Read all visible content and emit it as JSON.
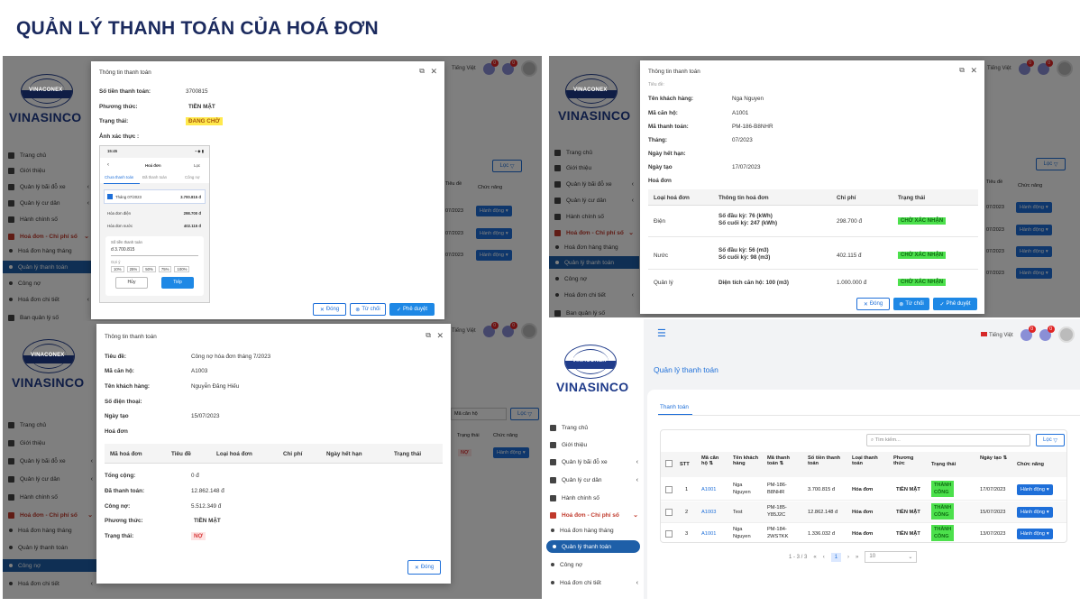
{
  "page_title": "QUẢN LÝ THANH TOÁN CỦA HOÁ ĐƠN",
  "brand": {
    "band": "VINACONEX",
    "name": "VINASINCO"
  },
  "menu": {
    "trang_chu": "Trang chủ",
    "gioi_thieu": "Giới thiệu",
    "bai_do_xe": "Quản lý bãi đỗ xe",
    "cu_dan": "Quản lý cư dân",
    "hanh_chinh": "Hành chính số",
    "hoa_don": "Hoá đơn - Chi phí số",
    "hd_hang_thang": "Hoá đơn hàng tháng",
    "ql_thanh_toan": "Quản lý thanh toán",
    "cong_no": "Công nợ",
    "hd_chi_tiet": "Hoá đơn chi tiết",
    "ban_quan_ly": "Ban quản lý số"
  },
  "topbar": {
    "language": "Tiếng Việt",
    "badge1": "0",
    "badge2": "0"
  },
  "buttons": {
    "dong": "Đóng",
    "tu_choi": "Từ chối",
    "phe_duyet": "Phê duyệt",
    "loc": "Lọc",
    "hanh_dong": "Hành động"
  },
  "p1": {
    "modal_title": "Thông tin thanh toán",
    "so_tien_label": "Số tiền thanh toán:",
    "so_tien": "3700815",
    "phuong_thuc_label": "Phương thức:",
    "phuong_thuc": "TIỀN MẶT",
    "trang_thai_label": "Trạng thái:",
    "trang_thai": "ĐANG CHỜ",
    "anh_label": "Ảnh xác thực :",
    "bg_col1": "Tiêu đề",
    "bg_col2": "Trạng thái",
    "bg_col3": "Chức năng",
    "phone": {
      "time": "15:45",
      "title": "Hoá đơn",
      "filter": "Lọc",
      "tab1": "Chưa thanh toán",
      "tab2": "Đã thanh toán",
      "tab3": "Công nợ",
      "month": "Tháng 07/2023",
      "month_amount": "3.700.815 đ",
      "line1_label": "Hóa đơn điện",
      "line1": "298.700 đ",
      "line2_label": "Hóa đơn nước",
      "line2": "402.115 đ",
      "input_label": "Số tiền thanh toán",
      "input_value": "đ 3.700.815",
      "hint": "Gợi ý",
      "chips": [
        "10%",
        "25%",
        "50%",
        "75%",
        "100%"
      ],
      "cancel": "Hủy",
      "next": "Tiếp"
    }
  },
  "p2": {
    "modal_title": "Thông tin thanh toán",
    "top_cut": "Tiêu đề:",
    "fields": [
      {
        "k": "Tên khách hàng:",
        "v": "Nga Nguyen"
      },
      {
        "k": "Mã căn hộ:",
        "v": "A1001"
      },
      {
        "k": "Mã thanh toán:",
        "v": "PM-186-B8NHR"
      },
      {
        "k": "Tháng:",
        "v": "07/2023"
      },
      {
        "k": "Ngày hết hạn:",
        "v": ""
      },
      {
        "k": "Ngày tạo",
        "v": "17/07/2023"
      },
      {
        "k": "Hoá đơn",
        "v": ""
      }
    ],
    "headers": [
      "Loại hoá đơn",
      "Thông tin hoá đơn",
      "Chi phí",
      "Trạng thái"
    ],
    "rows": [
      {
        "loai": "Điện",
        "info1": "Số đầu kỳ: 76 (kWh)",
        "info2": "Số cuối kỳ: 247 (kWh)",
        "chi_phi": "298.700 đ",
        "tt": "CHỜ XÁC NHẬN"
      },
      {
        "loai": "Nước",
        "info1": "Số đầu kỳ: 56 (m3)",
        "info2": "Số cuối kỳ: 98 (m3)",
        "chi_phi": "402.115 đ",
        "tt": "CHỜ XÁC NHẬN"
      },
      {
        "loai": "Quản lý",
        "info1": "Diện tích căn hộ: 100 (m3)",
        "info2": "",
        "chi_phi": "1.000.000 đ",
        "tt": "CHỜ XÁC NHẬN"
      }
    ],
    "bg_col1": "Tiêu đề",
    "bg_col2": "Chức năng"
  },
  "p3": {
    "modal_title": "Thông tin thanh toán",
    "fields": [
      {
        "k": "Tiêu đề:",
        "v": "Công nợ hóa đơn tháng 7/2023"
      },
      {
        "k": "Mã căn hộ:",
        "v": "A1003"
      },
      {
        "k": "Tên khách hàng:",
        "v": "Nguyễn Đăng Hiếu"
      },
      {
        "k": "Số điện thoại:",
        "v": ""
      },
      {
        "k": "Ngày tạo",
        "v": "15/07/2023"
      },
      {
        "k": "Hoá đơn",
        "v": ""
      }
    ],
    "headers": [
      "Mã hoá đơn",
      "Tiêu đề",
      "Loại hoá đơn",
      "Chi phí",
      "Ngày hết hạn",
      "Trạng thái"
    ],
    "tong_cong_label": "Tổng cộng:",
    "tong_cong": "0 đ",
    "da_tt_label": "Đã thanh toán:",
    "da_tt": "12.862.148 đ",
    "cong_no_label": "Công nợ:",
    "cong_no": "5.512.349 đ",
    "phuong_thuc_label": "Phương thức:",
    "phuong_thuc": "TIỀN MẶT",
    "trang_thai_label": "Trạng thái:",
    "trang_thai": "NỢ",
    "bg_search": "Mã căn hộ",
    "bg_col1": "Trạng thái",
    "bg_col2": "Chức năng",
    "bg_status": "NỢ"
  },
  "p4": {
    "page_heading": "Quản lý thanh toán",
    "tab": "Thanh toán",
    "search_placeholder": "Tìm kiếm...",
    "headers": [
      "STT",
      "Mã căn hộ",
      "Tên khách hàng",
      "Mã thanh toán",
      "Số tiền thanh toán",
      "Loại thanh toán",
      "Phương thức",
      "Trạng thái",
      "Ngày tạo",
      "Chức năng"
    ],
    "rows": [
      {
        "stt": "1",
        "can_ho": "A1001",
        "ten1": "Nga",
        "ten2": "Nguyen",
        "ma1": "PM-186-",
        "ma2": "B8NHR",
        "tien": "3.700.815 đ",
        "loai": "Hóa đơn",
        "pt": "TIỀN MẶT",
        "tt1": "THÀNH",
        "tt2": "CÔNG",
        "ngay": "17/07/2023"
      },
      {
        "stt": "2",
        "can_ho": "A1003",
        "ten1": "Test",
        "ten2": "",
        "ma1": "PM-185-",
        "ma2": "Y85J2C",
        "tien": "12.862.148 đ",
        "loai": "Hóa đơn",
        "pt": "TIỀN MẶT",
        "tt1": "THÀNH",
        "tt2": "CÔNG",
        "ngay": "15/07/2023"
      },
      {
        "stt": "3",
        "can_ho": "A1001",
        "ten1": "Nga",
        "ten2": "Nguyen",
        "ma1": "PM-184-",
        "ma2": "2WSTKK",
        "tien": "1.336.032 đ",
        "loai": "Hóa đơn",
        "pt": "TIỀN MẶT",
        "tt1": "THÀNH",
        "tt2": "CÔNG",
        "ngay": "13/07/2023"
      }
    ],
    "pagination": {
      "range": "1 - 3 / 3",
      "page": "1",
      "per_page": "10"
    }
  }
}
